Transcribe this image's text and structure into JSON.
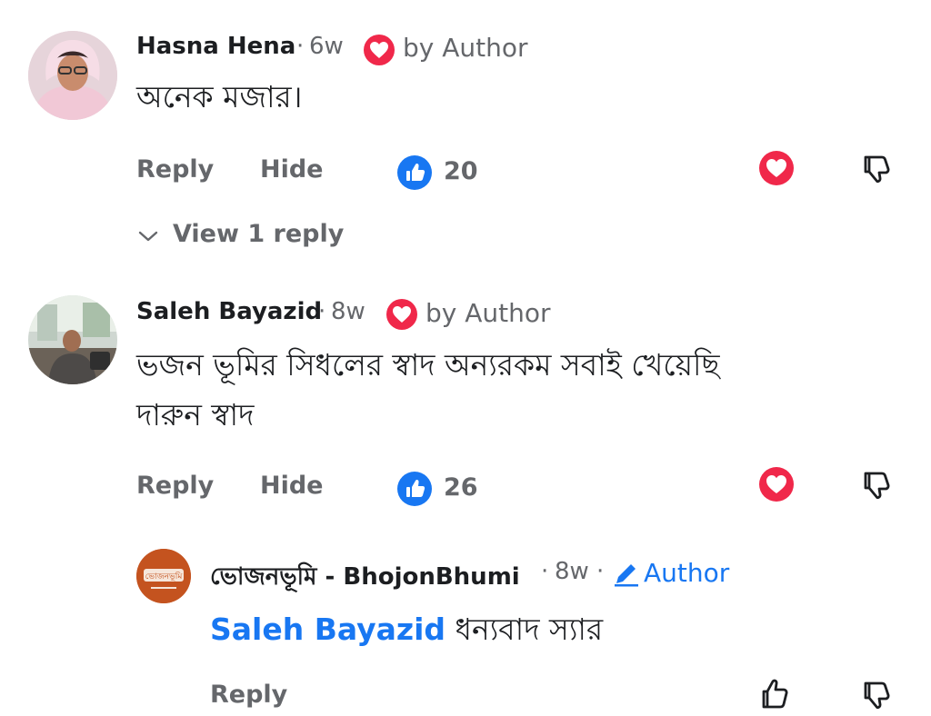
{
  "comments": [
    {
      "author": "Hasna Hena",
      "time": "6w",
      "badge": "by Author",
      "text": "অনেক মজার।",
      "actions": {
        "reply": "Reply",
        "hide": "Hide"
      },
      "like_count": "20",
      "view_replies": "View 1 reply"
    },
    {
      "author": "Saleh Bayazid",
      "time": "8w",
      "badge": "by Author",
      "text_line1": "ভজন ভূমির সিধলের স্বাদ অন্যরকম সবাই খেয়েছি",
      "text_line2": "দারুন স্বাদ",
      "actions": {
        "reply": "Reply",
        "hide": "Hide"
      },
      "like_count": "26"
    }
  ],
  "reply": {
    "author": "ভোজনভূমি - BhojonBhumi",
    "time": "8w",
    "badge": "Author",
    "mention": "Saleh Bayazid",
    "text": " ধন্যবাদ স্যার",
    "avatar_text": "ভোজনভূমি",
    "actions": {
      "reply": "Reply"
    }
  },
  "colors": {
    "like_blue": "#1877f2",
    "heart_red": "#f0284a",
    "secondary_text": "#65676b",
    "brand_orange": "#c4531f"
  }
}
